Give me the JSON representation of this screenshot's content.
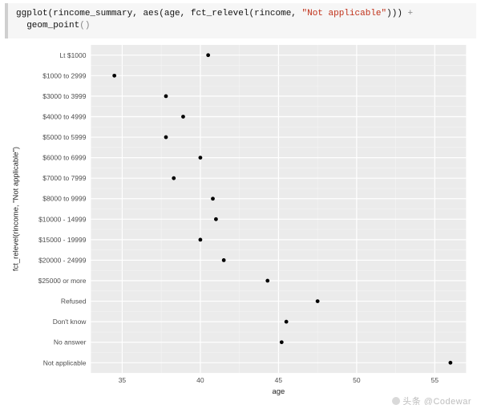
{
  "code": {
    "fn1": "ggplot",
    "args1_a": "(rincome_summary, ",
    "fn2": "aes",
    "args2_a": "(age, ",
    "fn3": "fct_relevel",
    "args3_a": "(rincome, ",
    "str1": "\"Not applicable\"",
    "args_close": "))) ",
    "plus": "+",
    "indent": "  ",
    "fn4": "geom_point",
    "parens": "()"
  },
  "chart_data": {
    "type": "scatter",
    "xlabel": "age",
    "ylabel": "fct_relevel(rincome, \"Not applicable\")",
    "xlim": [
      33,
      57
    ],
    "x_ticks": [
      35,
      40,
      45,
      50,
      55
    ],
    "categories_top_to_bottom": [
      "Lt $1000",
      "$1000 to 2999",
      "$3000 to 3999",
      "$4000 to 4999",
      "$5000 to 5999",
      "$6000 to 6999",
      "$7000 to 7999",
      "$8000 to 9999",
      "$10000 - 14999",
      "$15000 - 19999",
      "$20000 - 24999",
      "$25000 or more",
      "Refused",
      "Don't know",
      "No answer",
      "Not applicable"
    ],
    "points": [
      {
        "label": "Lt $1000",
        "age": 40.5
      },
      {
        "label": "$1000 to 2999",
        "age": 34.5
      },
      {
        "label": "$3000 to 3999",
        "age": 37.8
      },
      {
        "label": "$4000 to 4999",
        "age": 38.9
      },
      {
        "label": "$5000 to 5999",
        "age": 37.8
      },
      {
        "label": "$6000 to 6999",
        "age": 40.0
      },
      {
        "label": "$7000 to 7999",
        "age": 38.3
      },
      {
        "label": "$8000 to 9999",
        "age": 40.8
      },
      {
        "label": "$10000 - 14999",
        "age": 41.0
      },
      {
        "label": "$15000 - 19999",
        "age": 40.0
      },
      {
        "label": "$20000 - 24999",
        "age": 41.5
      },
      {
        "label": "$25000 or more",
        "age": 44.3
      },
      {
        "label": "Refused",
        "age": 47.5
      },
      {
        "label": "Don't know",
        "age": 45.5
      },
      {
        "label": "No answer",
        "age": 45.2
      },
      {
        "label": "Not applicable",
        "age": 56.0
      }
    ]
  },
  "watermark": "头条 @Codewar"
}
